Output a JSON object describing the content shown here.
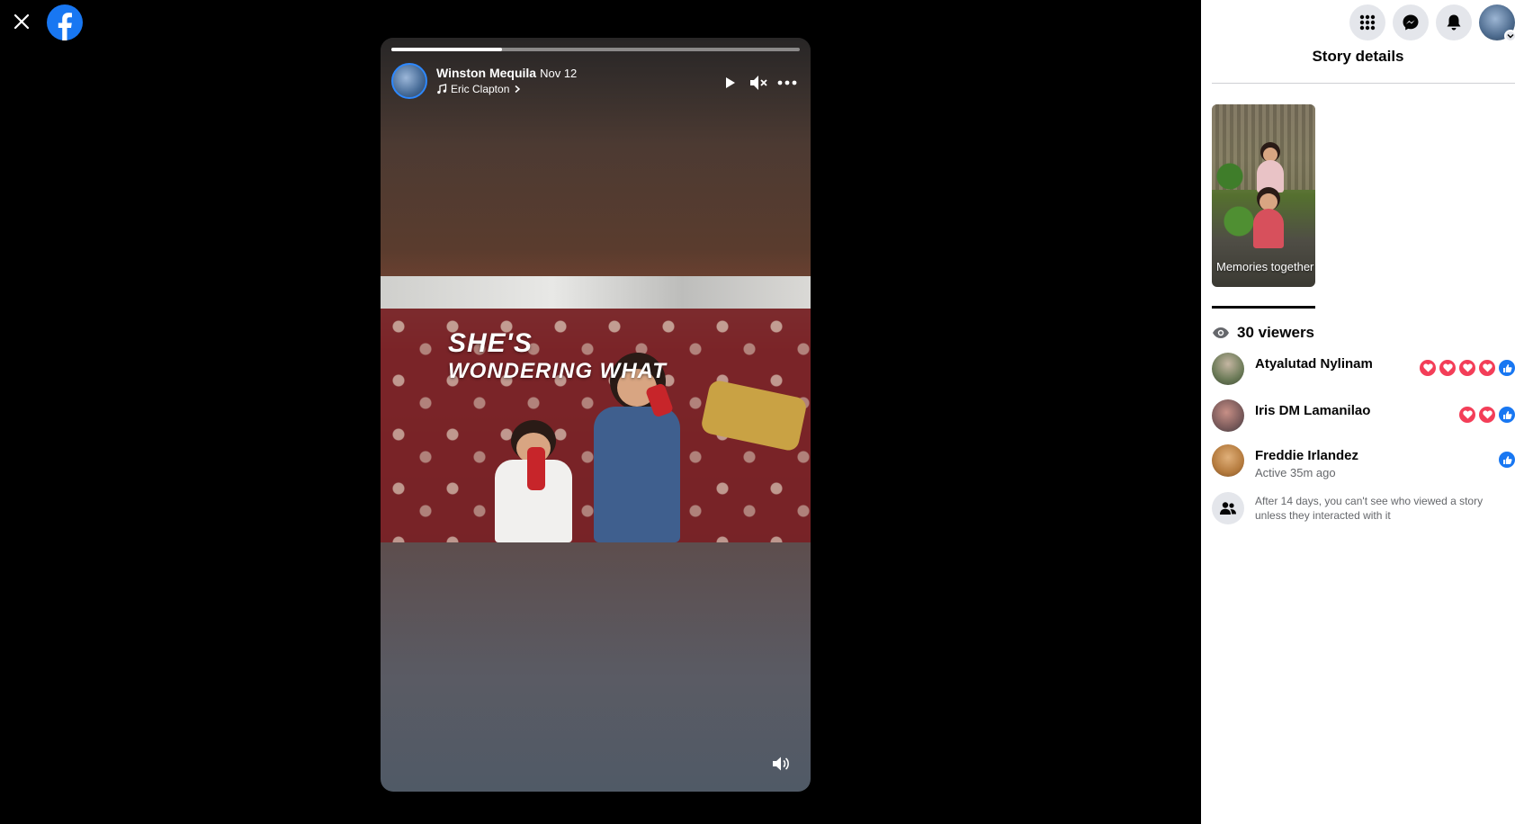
{
  "story": {
    "author": "Winston Mequila",
    "date": "Nov 12",
    "music": "Eric Clapton",
    "overlay_line1": "SHE'S",
    "overlay_line2": "WONDERING WHAT",
    "progress": 0.27
  },
  "panel": {
    "title": "Story details",
    "thumbnail_label": "Memories together",
    "viewers_label": "30 viewers",
    "viewers": [
      {
        "name": "Atyalutad Nylinam",
        "sub": "",
        "reactions": [
          "love",
          "love",
          "love",
          "love",
          "like"
        ]
      },
      {
        "name": "Iris DM Lamanilao",
        "sub": "",
        "reactions": [
          "love",
          "love",
          "like"
        ]
      },
      {
        "name": "Freddie Irlandez",
        "sub": "Active 35m ago",
        "reactions": [
          "like"
        ]
      }
    ],
    "note": "After 14 days, you can't see who viewed a story unless they interacted with it"
  },
  "icons": {
    "close": "close-icon",
    "logo": "facebook-logo-icon",
    "menu": "grid-menu-icon",
    "messenger": "messenger-icon",
    "notifications": "bell-icon",
    "play": "play-icon",
    "mute": "mute-icon",
    "more": "more-icon",
    "volume": "volume-icon",
    "eye": "eye-icon",
    "people": "people-icon"
  },
  "colors": {
    "brand": "#1877f2",
    "love": "#f33e58",
    "story_ring": "#2d88ff"
  }
}
